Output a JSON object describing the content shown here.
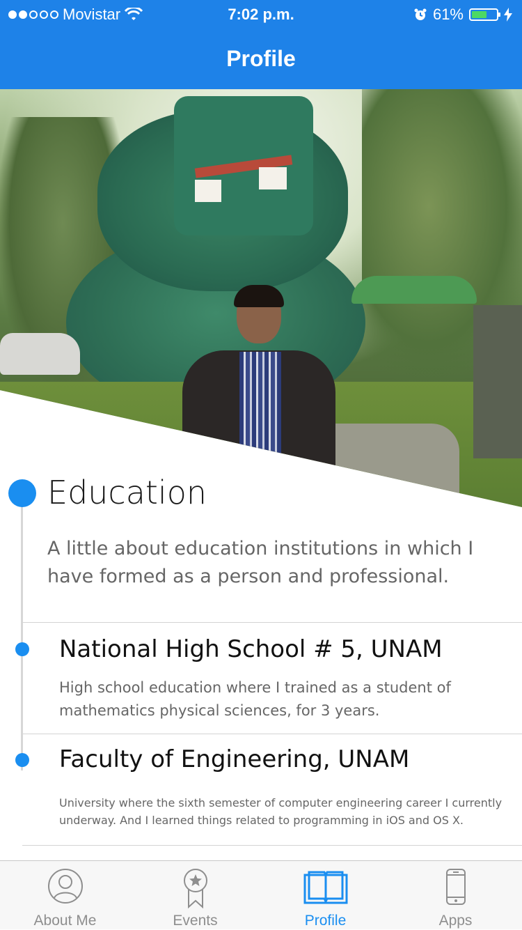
{
  "status_bar": {
    "carrier": "Movistar",
    "time": "7:02 p.m.",
    "battery_percent": "61%",
    "battery_level": 0.61,
    "signal_bars_filled": 2,
    "signal_bars_total": 5
  },
  "nav": {
    "title": "Profile"
  },
  "education": {
    "title": "Education",
    "description": "A little about education institutions in which I have formed as a person and professional.",
    "items": [
      {
        "title": "National High School # 5, UNAM",
        "description": "High school education where I trained as a student of mathematics physical sciences, for 3 years."
      },
      {
        "title": "Faculty of Engineering, UNAM",
        "description": "University where the sixth semester of computer engineering career I currently underway. And I learned things related to programming in iOS and OS X."
      }
    ]
  },
  "tabs": [
    {
      "label": "About Me",
      "icon": "person-icon"
    },
    {
      "label": "Events",
      "icon": "award-icon"
    },
    {
      "label": "Profile",
      "icon": "book-icon",
      "active": true
    },
    {
      "label": "Apps",
      "icon": "phone-icon"
    }
  ],
  "colors": {
    "accent": "#1a8ef0",
    "navbar": "#1e82e8",
    "battery": "#4cd964"
  }
}
